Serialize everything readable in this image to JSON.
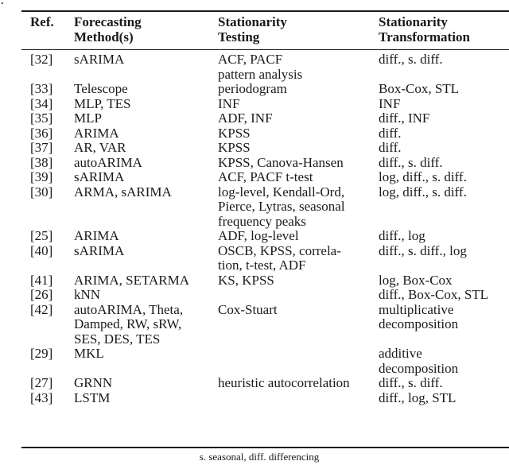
{
  "fragment_text": "s.",
  "table": {
    "headers": {
      "ref": [
        "Ref."
      ],
      "method": [
        "Forecasting",
        "Method(s)"
      ],
      "test": [
        "Stationarity",
        "Testing"
      ],
      "trans": [
        "Stationarity",
        "Transformation"
      ]
    },
    "rows": [
      {
        "ref": "[32]",
        "method": "sARIMA",
        "test": "ACF, PACF\npattern analysis",
        "trans": "diff., s. diff."
      },
      {
        "ref": "[33]",
        "method": "Telescope",
        "test": "periodogram",
        "trans": "Box-Cox, STL"
      },
      {
        "ref": "[34]",
        "method": "MLP, TES",
        "test": "INF",
        "trans": "INF"
      },
      {
        "ref": "[35]",
        "method": "MLP",
        "test": "ADF, INF",
        "trans": "diff., INF"
      },
      {
        "ref": "[36]",
        "method": "ARIMA",
        "test": "KPSS",
        "trans": "diff."
      },
      {
        "ref": "[37]",
        "method": "AR, VAR",
        "test": "KPSS",
        "trans": "diff."
      },
      {
        "ref": "[38]",
        "method": "autoARIMA",
        "test": "KPSS, Canova-Hansen",
        "trans": "diff., s. diff."
      },
      {
        "ref": "[39]",
        "method": "sARIMA",
        "test": "ACF, PACF t-test",
        "trans": "log, diff., s. diff."
      },
      {
        "ref": "[30]",
        "method": "ARMA, sARIMA",
        "test": "log-level, Kendall-Ord,\nPierce, Lytras, seasonal\nfrequency peaks",
        "trans": "log, diff., s. diff."
      },
      {
        "ref": "[25]",
        "method": "ARIMA",
        "test": "ADF, log-level",
        "trans": "diff., log"
      },
      {
        "ref": "[40]",
        "method": "sARIMA",
        "test": "OSCB, KPSS, correla-\ntion, t-test, ADF",
        "trans": "diff., s. diff., log"
      },
      {
        "ref": "[41]",
        "method": "ARIMA, SETARMA",
        "test": "KS, KPSS",
        "trans": "log, Box-Cox"
      },
      {
        "ref": "[26]",
        "method": "kNN",
        "test": "",
        "trans": "diff., Box-Cox, STL"
      },
      {
        "ref": "[42]",
        "method": "autoARIMA, Theta,\nDamped, RW, sRW,\nSES, DES, TES",
        "test": "Cox-Stuart",
        "trans": "multiplicative\ndecomposition"
      },
      {
        "ref": "[29]",
        "method": "MKL",
        "test": "",
        "trans": "additive\ndecomposition"
      },
      {
        "ref": "[27]",
        "method": "GRNN",
        "test": "heuristic autocorrelation",
        "trans": "diff., s. diff."
      },
      {
        "ref": "[43]",
        "method": "LSTM",
        "test": "",
        "trans": "diff., log, STL"
      }
    ],
    "footnote": "s. seasonal, diff. differencing"
  }
}
